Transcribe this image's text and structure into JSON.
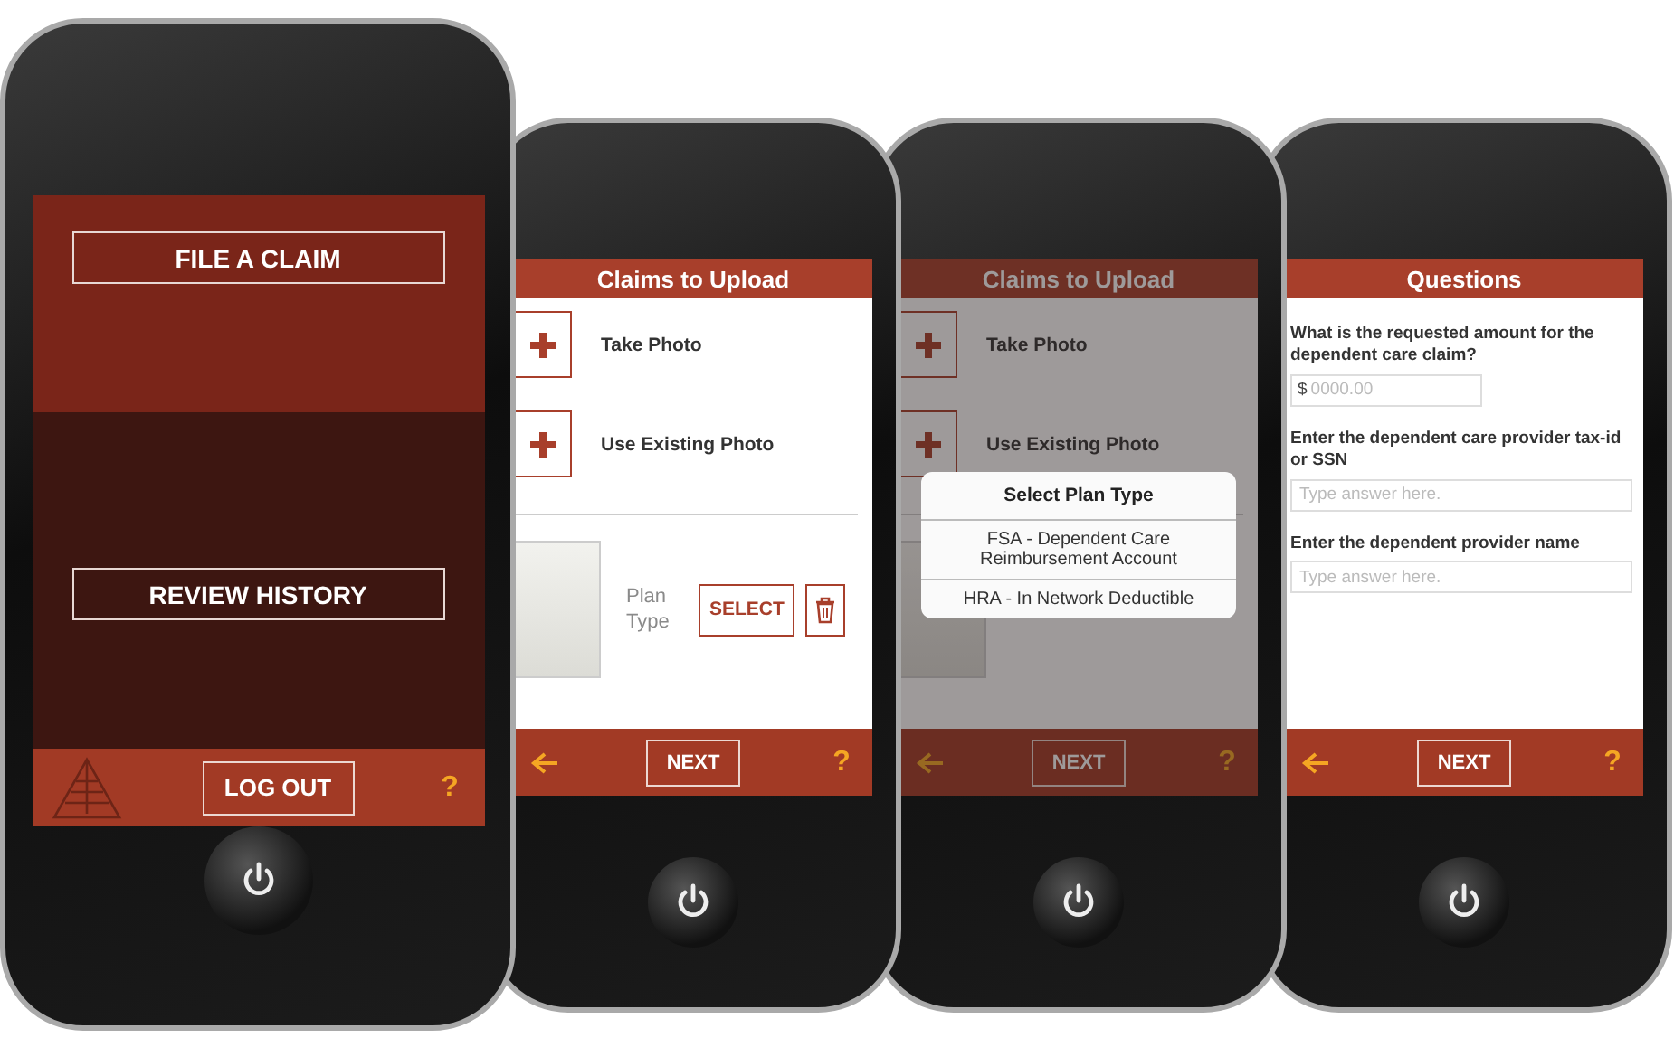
{
  "phones": [
    {
      "kind": "home",
      "sections": [
        "FILE A CLAIM",
        "REVIEW HISTORY"
      ],
      "footer": {
        "button": "LOG OUT",
        "help": "?"
      }
    },
    {
      "kind": "upload",
      "title": "Claims to Upload",
      "actions": [
        "Take Photo",
        "Use Existing Photo"
      ],
      "claim": {
        "label": "Plan Type",
        "button": "SELECT"
      },
      "footer": {
        "button": "NEXT",
        "help": "?"
      }
    },
    {
      "kind": "upload",
      "title": "Claims to Upload",
      "actions": [
        "Take Photo",
        "Use Existing Photo"
      ],
      "dialog": {
        "title": "Select Plan Type",
        "options": [
          "FSA - Dependent Care Reimbursement Account",
          "HRA - In Network Deductible"
        ]
      },
      "footer": {
        "button": "NEXT",
        "help": "?"
      }
    },
    {
      "kind": "questions",
      "title": "Questions",
      "questions": [
        {
          "label": "What is the requested amount for the dependent care claim?",
          "prefix": "$",
          "placeholder": "0000.00"
        },
        {
          "label": "Enter the dependent care provider tax-id or SSN",
          "placeholder": "Type answer here."
        },
        {
          "label": "Enter the dependent provider name",
          "placeholder": "Type answer here."
        }
      ],
      "footer": {
        "button": "NEXT",
        "help": "?"
      }
    }
  ]
}
